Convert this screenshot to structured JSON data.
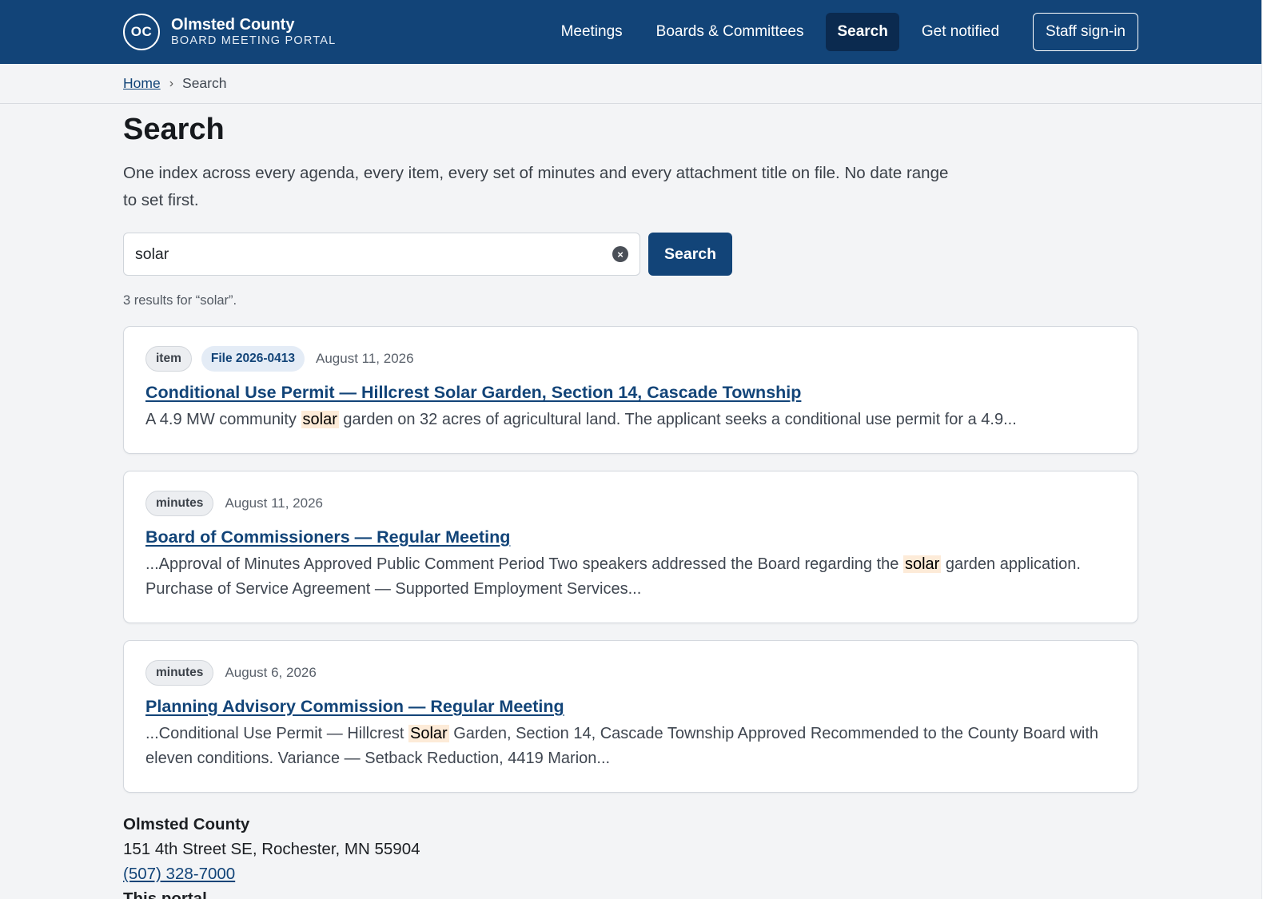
{
  "header": {
    "logo_initials": "OC",
    "brand_name": "Olmsted County",
    "brand_sub": "BOARD MEETING PORTAL",
    "nav": {
      "meetings": "Meetings",
      "boards": "Boards & Committees",
      "search": "Search",
      "notified": "Get notified",
      "staff": "Staff sign-in"
    }
  },
  "breadcrumb": {
    "home": "Home",
    "separator": "›",
    "current": "Search"
  },
  "page": {
    "title": "Search",
    "intro": "One index across every agenda, every item, every set of minutes and every attachment title on file. No date range to set first."
  },
  "search": {
    "value": "solar",
    "clear_icon": "×",
    "button_label": "Search",
    "result_count": "3 results for “solar”."
  },
  "results": [
    {
      "type": "item",
      "file": "File 2026-0413",
      "date": "August 11, 2026",
      "title": "Conditional Use Permit — Hillcrest Solar Garden, Section 14, Cascade Township",
      "snippet_before": "A 4.9 MW community ",
      "snippet_match": "solar",
      "snippet_after": " garden on 32 acres of agricultural land. The applicant seeks a conditional use permit for a 4.9..."
    },
    {
      "type": "minutes",
      "date": "August 11, 2026",
      "title": "Board of Commissioners — Regular Meeting",
      "snippet_before": "...Approval of Minutes Approved Public Comment Period Two speakers addressed the Board regarding the ",
      "snippet_match": "solar",
      "snippet_after": " garden application. Purchase of Service Agreement — Supported Employment Services..."
    },
    {
      "type": "minutes",
      "date": "August 6, 2026",
      "title": "Planning Advisory Commission — Regular Meeting",
      "snippet_before": "...Conditional Use Permit — Hillcrest ",
      "snippet_match": "Solar",
      "snippet_after": " Garden, Section 14, Cascade Township Approved Recommended to the County Board with eleven conditions. Variance — Setback Reduction, 4419 Marion..."
    }
  ],
  "footer": {
    "name": "Olmsted County",
    "address": "151 4th Street SE, Rochester, MN 55904",
    "phone": "(507) 328-7000",
    "portal_heading": "This portal"
  },
  "colors": {
    "brand": "#124478",
    "nav_active": "#0b2a4f",
    "highlight": "#fdebd8"
  }
}
